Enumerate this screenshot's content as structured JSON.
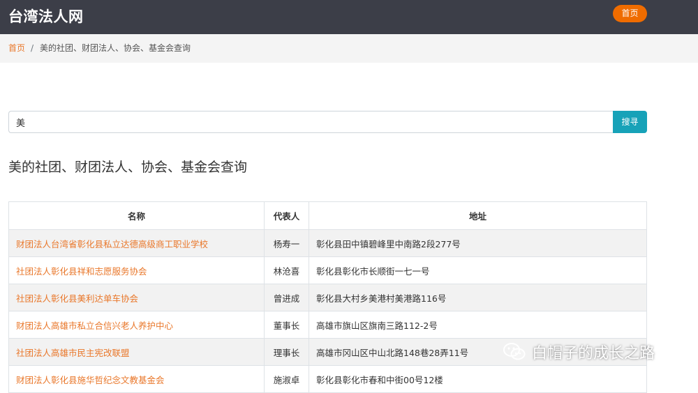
{
  "header": {
    "brand": "台湾法人网",
    "home_button": "首页"
  },
  "breadcrumb": {
    "home": "首页",
    "separator": "/",
    "current": "美的社团、财团法人、协会、基金会查询"
  },
  "search": {
    "value": "美",
    "button": "搜寻"
  },
  "page_title": "美的社团、财团法人、协会、基金会查询",
  "table": {
    "headers": [
      "名称",
      "代表人",
      "地址"
    ],
    "rows": [
      {
        "name": "财团法人台湾省彰化县私立达德高级商工职业学校",
        "rep": "杨寿一",
        "addr": "彰化县田中镇碧峰里中南路2段277号"
      },
      {
        "name": "社团法人彰化县祥和志愿服务协会",
        "rep": "林沧喜",
        "addr": "彰化县彰化市长顺街一七一号"
      },
      {
        "name": "社团法人彰化县美利达单车协会",
        "rep": "曾进成",
        "addr": "彰化县大村乡美港村美港路116号"
      },
      {
        "name": "财团法人高雄市私立合信兴老人养护中心",
        "rep": "董事长",
        "addr": "高雄市旗山区旗南三路112-2号"
      },
      {
        "name": "社团法人高雄市民主宪改联盟",
        "rep": "理事长",
        "addr": "高雄市冈山区中山北路148巷28弄11号"
      },
      {
        "name": "财团法人彰化县施华哲纪念文教基金会",
        "rep": "施淑卓",
        "addr": "彰化县彰化市春和中街00号12楼"
      }
    ]
  },
  "watermark": "白帽子的成长之路",
  "colors": {
    "navbar": "#3c3e48",
    "accent": "#ef6c00",
    "link": "#e9772a",
    "search_button": "#17a2b8"
  }
}
